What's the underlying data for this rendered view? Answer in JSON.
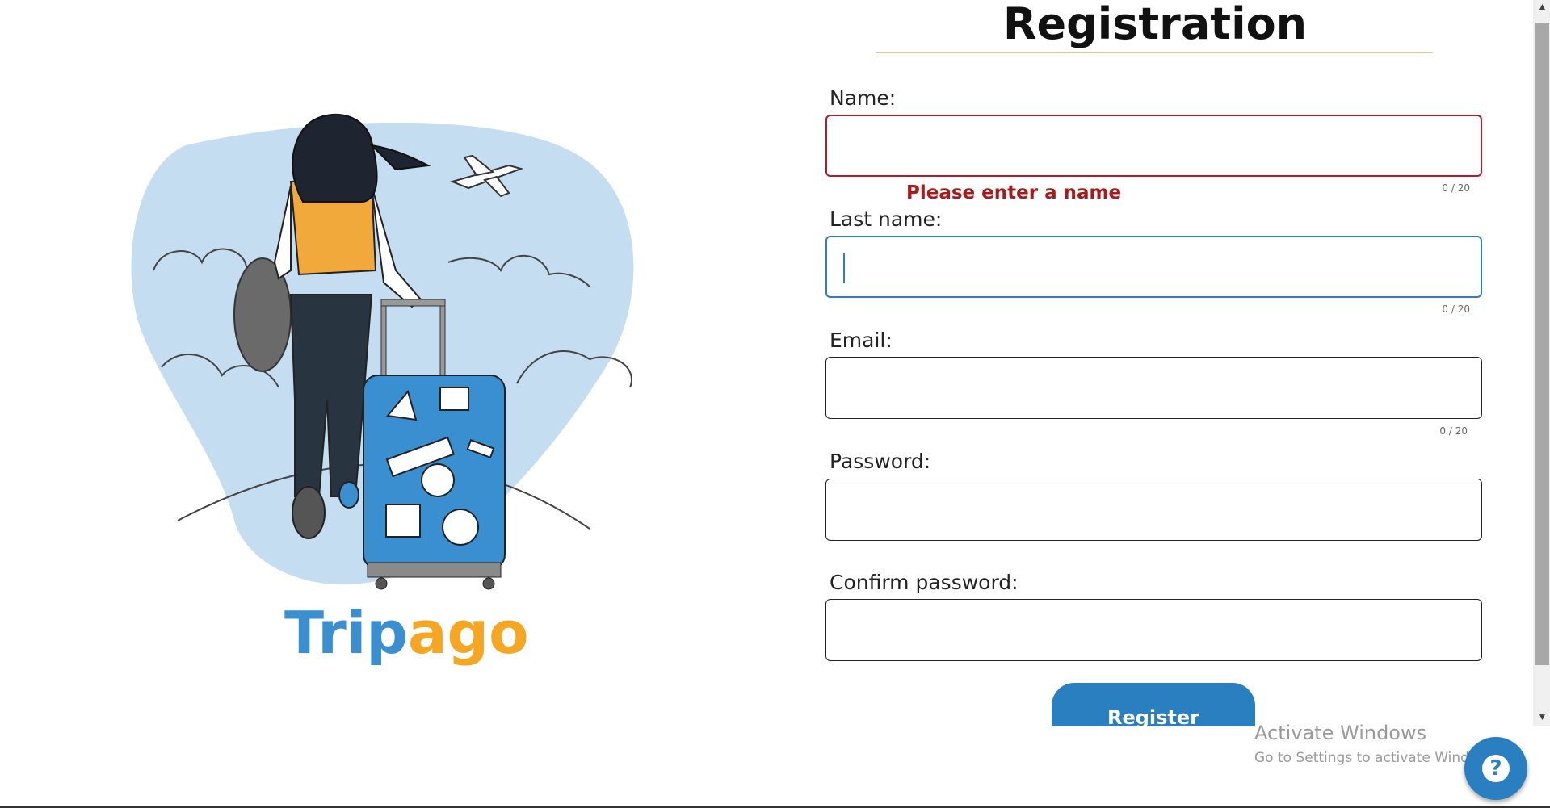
{
  "brand": {
    "part1": "Trip",
    "part2": "ago"
  },
  "form": {
    "title": "Registration",
    "fields": [
      {
        "label": "Name:",
        "value": "",
        "counter": "0 / 20",
        "error": "Please enter a name"
      },
      {
        "label": "Last name:",
        "value": "",
        "counter": "0 / 20"
      },
      {
        "label": "Email:",
        "value": "",
        "counter": "0 / 20"
      },
      {
        "label": "Password:",
        "value": ""
      },
      {
        "label": "Confirm password:",
        "value": ""
      }
    ],
    "submit_label": "Register"
  },
  "watermark": {
    "title": "Activate Windows",
    "subtitle": "Go to Settings to activate Windows."
  },
  "help": {
    "glyph": "?"
  },
  "scrollbar": {
    "up_glyph": "▲",
    "down_glyph": "▼"
  },
  "colors": {
    "brand_blue": "#3a8fd1",
    "brand_orange": "#f5a623",
    "error": "#b01c2e",
    "focus": "#2d7ec4",
    "button": "#2a7fc0"
  }
}
